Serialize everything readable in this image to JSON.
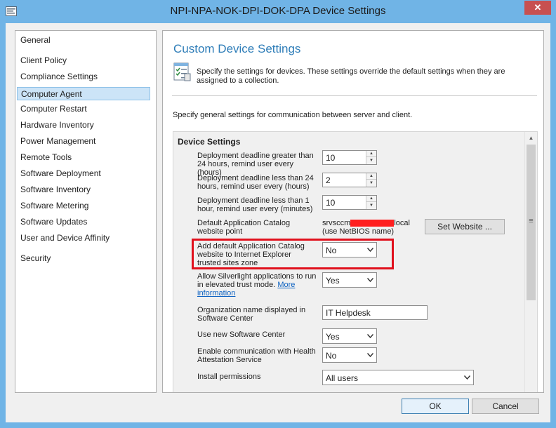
{
  "window": {
    "title": "NPI-NPA-NOK-DPI-DOK-DPA Device Settings",
    "close_label": "✕",
    "accent": "#70b4e6"
  },
  "sidebar": {
    "items": [
      {
        "label": "General",
        "selected": false
      },
      {
        "label": "Client Policy",
        "selected": false
      },
      {
        "label": "Compliance Settings",
        "selected": false
      },
      {
        "label": "Computer Agent",
        "selected": true
      },
      {
        "label": "Computer Restart",
        "selected": false
      },
      {
        "label": "Hardware Inventory",
        "selected": false
      },
      {
        "label": "Power Management",
        "selected": false
      },
      {
        "label": "Remote Tools",
        "selected": false
      },
      {
        "label": "Software Deployment",
        "selected": false
      },
      {
        "label": "Software Inventory",
        "selected": false
      },
      {
        "label": "Software Metering",
        "selected": false
      },
      {
        "label": "Software Updates",
        "selected": false
      },
      {
        "label": "User and Device Affinity",
        "selected": false
      },
      {
        "label": "Security",
        "selected": false
      }
    ]
  },
  "main": {
    "title": "Custom Device Settings",
    "description": "Specify the settings for devices. These settings override the default settings when they are assigned to a collection.",
    "general_text": "Specify general settings for communication between server and client.",
    "section_title": "Device Settings",
    "settings": {
      "deadline_gt24": {
        "label": "Deployment deadline greater than 24 hours, remind user every (hours)",
        "value": "10"
      },
      "deadline_lt24": {
        "label": "Deployment deadline less than 24 hours, remind user every (hours)",
        "value": "2"
      },
      "deadline_lt1": {
        "label": "Deployment deadline less than 1 hour, remind user every (minutes)",
        "value": "10"
      },
      "catalog": {
        "label": "Default Application Catalog website point",
        "value_prefix": "srvsccm",
        "value_suffix": "local",
        "value_line2": "(use NetBIOS name)",
        "button": "Set Website ..."
      },
      "trusted_sites": {
        "label": "Add default Application Catalog website to Internet Explorer trusted sites zone",
        "value": "No"
      },
      "silverlight": {
        "label": "Allow Silverlight applications to run in elevated trust mode. ",
        "link": "More information",
        "value": "Yes"
      },
      "org_name": {
        "label": "Organization name displayed in Software Center",
        "value": "IT Helpdesk"
      },
      "new_software_center": {
        "label": "Use new Software Center",
        "value": "Yes"
      },
      "health_attestation": {
        "label": "Enable communication with Health Attestation Service",
        "value": "No"
      },
      "install_permissions": {
        "label": "Install permissions",
        "value": "All users"
      }
    }
  },
  "footer": {
    "ok_label": "OK",
    "cancel_label": "Cancel"
  },
  "colors": {
    "title_blue": "#2e7db8",
    "highlight_red": "#e0101c",
    "selection": "#cce4f7"
  }
}
